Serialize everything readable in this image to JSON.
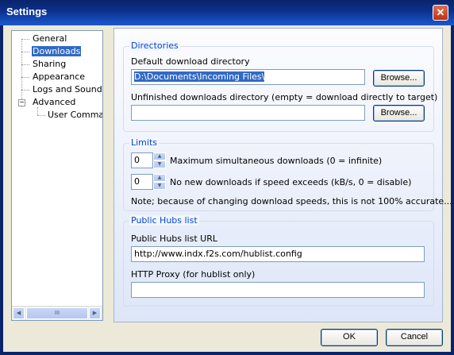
{
  "window": {
    "title": "Settings",
    "close_glyph": "✕"
  },
  "tree": {
    "items": [
      {
        "label": "General"
      },
      {
        "label": "Downloads"
      },
      {
        "label": "Sharing"
      },
      {
        "label": "Appearance"
      },
      {
        "label": "Logs and Sound"
      },
      {
        "label": "Advanced"
      },
      {
        "label": "User Commands"
      }
    ],
    "expander_glyph": "−",
    "scroll_left": "◀",
    "scroll_right": "▶",
    "scroll_thumb_grip": "III"
  },
  "directories": {
    "title": "Directories",
    "default_label": "Default download directory",
    "default_value": "D:\\Documents\\Incoming Files\\",
    "unfinished_label": "Unfinished downloads directory (empty = download directly to target)",
    "unfinished_value": "",
    "browse_label": "Browse..."
  },
  "limits": {
    "title": "Limits",
    "max_downloads_value": "0",
    "max_downloads_label": "Maximum simultaneous downloads (0 = infinite)",
    "speed_value": "0",
    "speed_label": "No new downloads if speed exceeds (kB/s, 0 = disable)",
    "note": "Note; because of changing download speeds, this is not 100% accurate...",
    "spin_up": "▲",
    "spin_down": "▼"
  },
  "hubs": {
    "title": "Public Hubs list",
    "url_label": "Public Hubs list URL",
    "url_value": "http://www.indx.f2s.com/hublist.config",
    "proxy_label": "HTTP Proxy (for hublist only)",
    "proxy_value": ""
  },
  "footer": {
    "ok_label": "OK",
    "cancel_label": "Cancel"
  },
  "colors": {
    "titlebar": "#0a246a",
    "accent": "#0046d5",
    "selection": "#316ac5",
    "face": "#ece9d8"
  }
}
